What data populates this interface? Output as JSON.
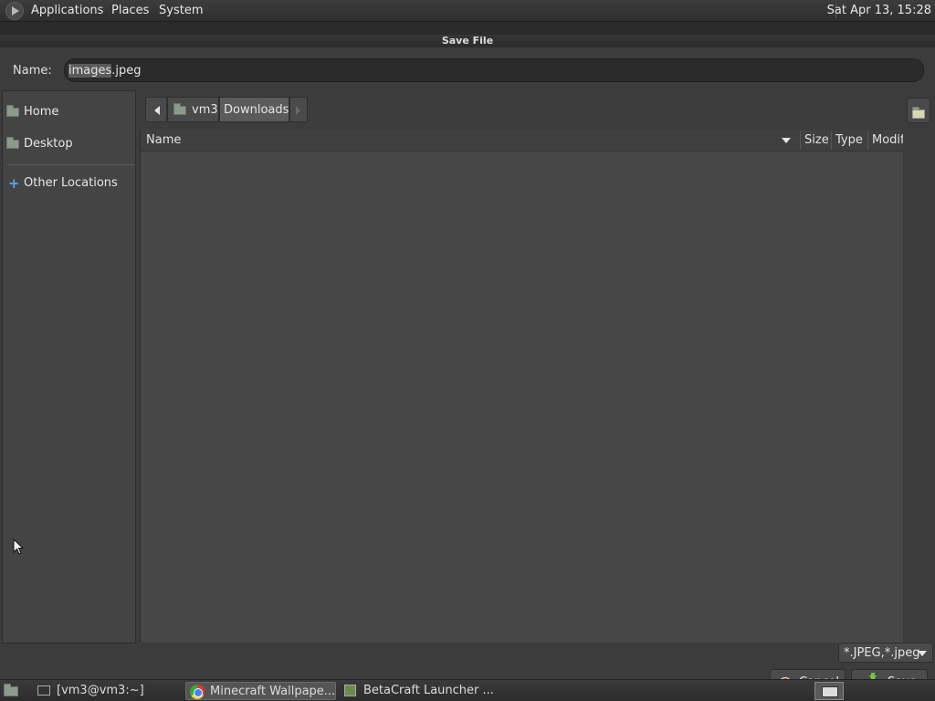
{
  "top_panel": {
    "menus": [
      "Applications",
      "Places",
      "System"
    ],
    "clock": "Sat Apr 13, 15:28"
  },
  "dialog": {
    "title": "Save File",
    "name_label": "Name:",
    "name_value": "images.jpeg",
    "name_selected_part": "images",
    "name_rest_part": ".jpeg",
    "sidebar": {
      "items": [
        {
          "label": "Home",
          "icon": "home-folder-icon"
        },
        {
          "label": "Desktop",
          "icon": "desktop-folder-icon"
        },
        {
          "label": "Other Locations",
          "icon": "plus-icon"
        }
      ]
    },
    "path": {
      "segments": [
        "vm3",
        "Downloads"
      ],
      "active_segment": "Downloads"
    },
    "columns": [
      "Name",
      "Size",
      "Type",
      "Modif"
    ],
    "filter": "*.JPEG,*.jpeg",
    "buttons": {
      "cancel": "Cancel",
      "save": "Save"
    }
  },
  "taskbar": {
    "tasks": [
      {
        "label": "[vm3@vm3:~]",
        "icon": "terminal-icon"
      },
      {
        "label": "Minecraft Wallpape...",
        "icon": "chrome-icon",
        "active": true
      },
      {
        "label": "BetaCraft Launcher ...",
        "icon": "betacraft-icon"
      }
    ]
  },
  "colors": {
    "background": "#3c3c3c",
    "list_background": "#474747",
    "cancel_icon": "#e01b1b",
    "save_icon": "#7ac142",
    "accent_plus": "#5ea2e6"
  }
}
